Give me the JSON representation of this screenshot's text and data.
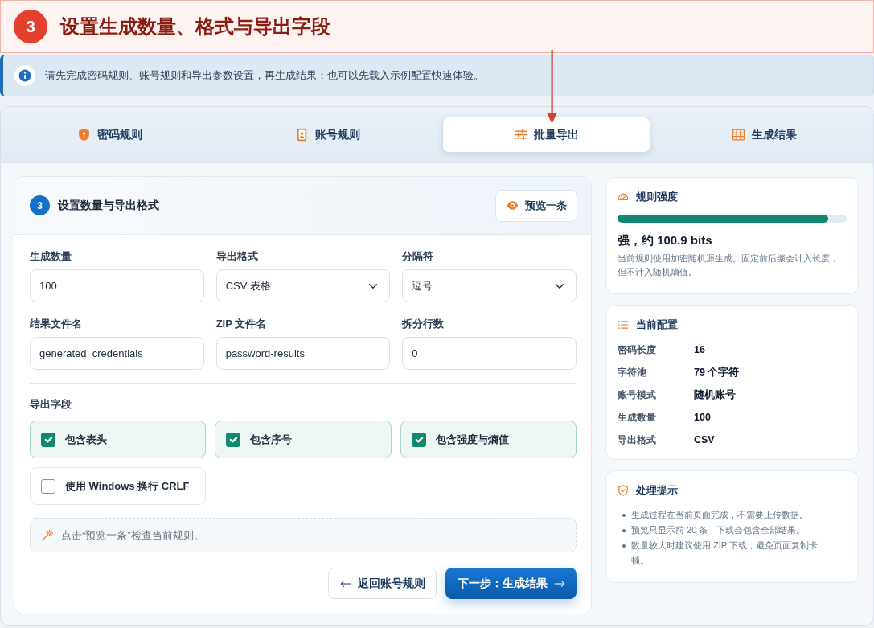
{
  "annotation": {
    "number": "3",
    "title": "设置生成数量、格式与导出字段"
  },
  "alert": {
    "text": "请先完成密码规则、账号规则和导出参数设置，再生成结果；也可以先载入示例配置快速体验。"
  },
  "tabs": [
    {
      "label": "密码规则",
      "selected": false
    },
    {
      "label": "账号规则",
      "selected": false
    },
    {
      "label": "批量导出",
      "selected": true
    },
    {
      "label": "生成结果",
      "selected": false
    }
  ],
  "section": {
    "step": "3",
    "title": "设置数量与导出格式",
    "preview_button": "预览一条"
  },
  "fields": [
    {
      "label": "生成数量",
      "kind": "input",
      "value": "100"
    },
    {
      "label": "导出格式",
      "kind": "select",
      "value": "CSV 表格"
    },
    {
      "label": "分隔符",
      "kind": "select",
      "value": "逗号"
    },
    {
      "label": "结果文件名",
      "kind": "input",
      "value": "generated_credentials"
    },
    {
      "label": "ZIP 文件名",
      "kind": "input",
      "value": "password-results"
    },
    {
      "label": "拆分行数",
      "kind": "input",
      "value": "0"
    }
  ],
  "export_fields": {
    "label": "导出字段",
    "options": [
      {
        "label": "包含表头",
        "checked": true
      },
      {
        "label": "包含序号",
        "checked": true
      },
      {
        "label": "包含强度与熵值",
        "checked": true
      },
      {
        "label": "使用 Windows 换行 CRLF",
        "checked": false
      }
    ]
  },
  "hint": "点击“预览一条”检查当前规则。",
  "buttons": {
    "back": "返回账号规则",
    "next": "下一步：生成结果"
  },
  "strength": {
    "title": "规则强度",
    "level": 0.92,
    "summary": "强，约 100.9 bits",
    "description": "当前规则使用加密随机源生成。固定前后缀会计入长度，但不计入随机熵值。"
  },
  "config": {
    "title": "当前配置",
    "rows": [
      {
        "label": "密码长度",
        "value": "16"
      },
      {
        "label": "字符池",
        "value": "79 个字符"
      },
      {
        "label": "账号模式",
        "value": "随机账号"
      },
      {
        "label": "生成数量",
        "value": "100"
      },
      {
        "label": "导出格式",
        "value": "CSV"
      }
    ]
  },
  "tips": {
    "title": "处理提示",
    "items": [
      "生成过程在当前页面完成，不需要上传数据。",
      "预览只显示前 20 条，下载会包含全部结果。",
      "数量较大时建议使用 ZIP 下载，避免页面复制卡顿。"
    ]
  }
}
